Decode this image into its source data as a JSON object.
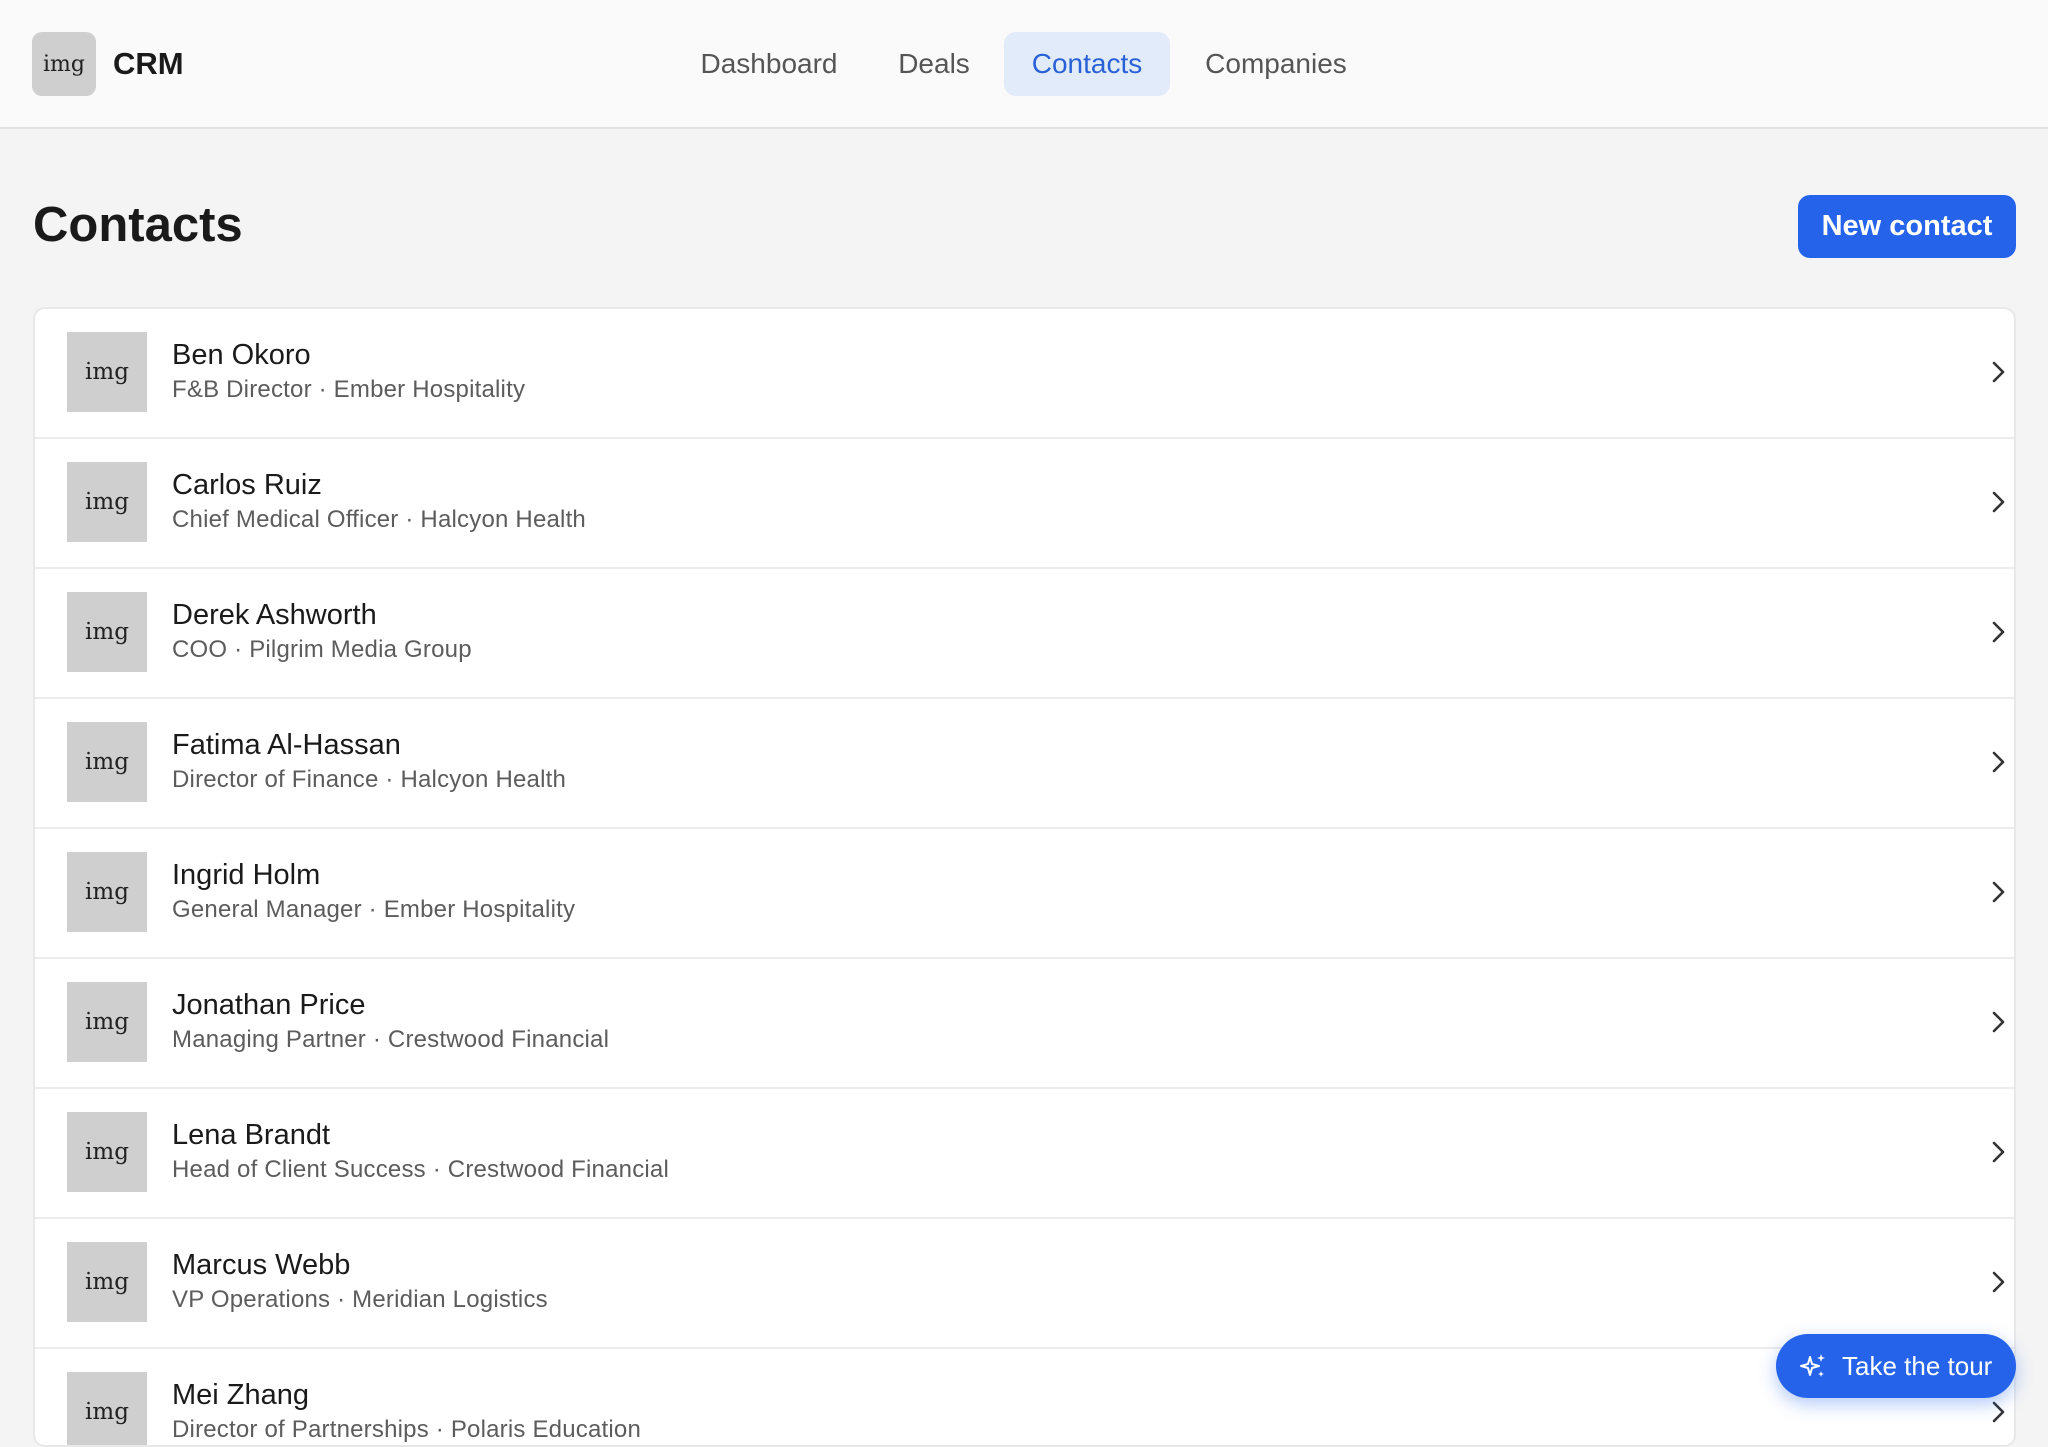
{
  "header": {
    "logo_text": "img",
    "app_title": "CRM",
    "tabs": [
      {
        "label": "Dashboard",
        "active": false
      },
      {
        "label": "Deals",
        "active": false
      },
      {
        "label": "Contacts",
        "active": true
      },
      {
        "label": "Companies",
        "active": false
      }
    ]
  },
  "page": {
    "title": "Contacts",
    "new_button_label": "New contact"
  },
  "contacts": [
    {
      "avatar": "img",
      "name": "Ben Okoro",
      "subtitle": "F&B Director · Ember Hospitality"
    },
    {
      "avatar": "img",
      "name": "Carlos Ruiz",
      "subtitle": "Chief Medical Officer · Halcyon Health"
    },
    {
      "avatar": "img",
      "name": "Derek Ashworth",
      "subtitle": "COO · Pilgrim Media Group"
    },
    {
      "avatar": "img",
      "name": "Fatima Al-Hassan",
      "subtitle": "Director of Finance · Halcyon Health"
    },
    {
      "avatar": "img",
      "name": "Ingrid Holm",
      "subtitle": "General Manager · Ember Hospitality"
    },
    {
      "avatar": "img",
      "name": "Jonathan Price",
      "subtitle": "Managing Partner · Crestwood Financial"
    },
    {
      "avatar": "img",
      "name": "Lena Brandt",
      "subtitle": "Head of Client Success · Crestwood Financial"
    },
    {
      "avatar": "img",
      "name": "Marcus Webb",
      "subtitle": "VP Operations · Meridian Logistics"
    },
    {
      "avatar": "img",
      "name": "Mei Zhang",
      "subtitle": "Director of Partnerships · Polaris Education"
    }
  ],
  "tour_button": {
    "label": "Take the tour",
    "icon": "sparkles-icon"
  },
  "colors": {
    "accent": "#2563eb",
    "active_tab_bg": "#e2ebfa",
    "active_tab_text": "#2962d6",
    "page_bg": "#f4f4f4"
  }
}
